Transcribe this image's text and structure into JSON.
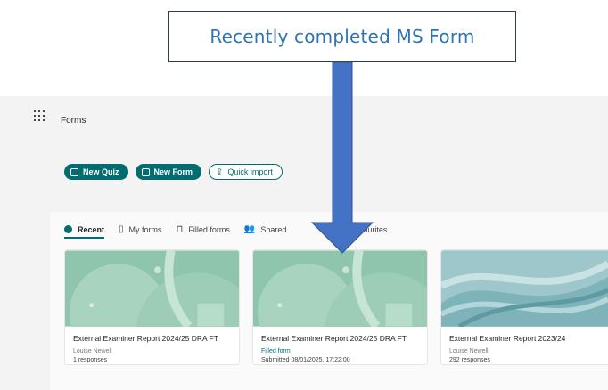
{
  "annotation": {
    "text": "Recently completed MS Form"
  },
  "app": {
    "title": "Forms"
  },
  "actions": {
    "new_quiz": "New Quiz",
    "new_form": "New Form",
    "quick_import": "Quick import"
  },
  "tabs": [
    {
      "label": "Recent",
      "icon": "recent-icon",
      "active": true
    },
    {
      "label": "My forms",
      "icon": "document-icon"
    },
    {
      "label": "Filled forms",
      "icon": "bookmark-icon"
    },
    {
      "label": "Shared",
      "icon": "people-icon"
    },
    {
      "label": "Favourites",
      "icon": "star-icon"
    }
  ],
  "cards": [
    {
      "title": "External Examiner Report 2024/25 DRA FT",
      "meta1": "Louise Newell",
      "meta2": "1 responses"
    },
    {
      "title": "External Examiner Report 2024/25 DRA FT",
      "meta1": "Filled form",
      "meta2": "Submitted 08/01/2025, 17:22:00"
    },
    {
      "title": "External Examiner Report 2023/24",
      "meta1": "Louise Newell",
      "meta2": "292 responses"
    }
  ],
  "colors": {
    "accent": "#036c70",
    "annotation_text": "#2e74b5",
    "arrow": "#4472c4"
  }
}
